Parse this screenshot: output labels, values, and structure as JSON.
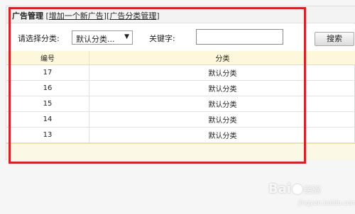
{
  "header": {
    "title": "广告管理",
    "bracket_open_1": "[",
    "link_add": "增加一个新广告",
    "bracket_close_1": "]",
    "bracket_open_2": "[",
    "link_categories": "广告分类管理",
    "bracket_close_2": "]"
  },
  "filter": {
    "category_label": "请选择分类:",
    "category_selected": "默认分类...",
    "keyword_label": "关键字:",
    "keyword_value": "",
    "search_button": "搜索"
  },
  "table": {
    "columns": [
      "编号",
      "分类"
    ],
    "rows": [
      {
        "id": "17",
        "category": "默认分类"
      },
      {
        "id": "16",
        "category": "默认分类"
      },
      {
        "id": "15",
        "category": "默认分类"
      },
      {
        "id": "14",
        "category": "默认分类"
      },
      {
        "id": "13",
        "category": "默认分类"
      }
    ]
  },
  "watermark": {
    "brand": "Bai",
    "brand_suffix": "经验",
    "url": "jingyan.baidu.com"
  },
  "colors": {
    "highlight_border": "#d0242a",
    "table_header_bg": "#fdf8dc"
  }
}
